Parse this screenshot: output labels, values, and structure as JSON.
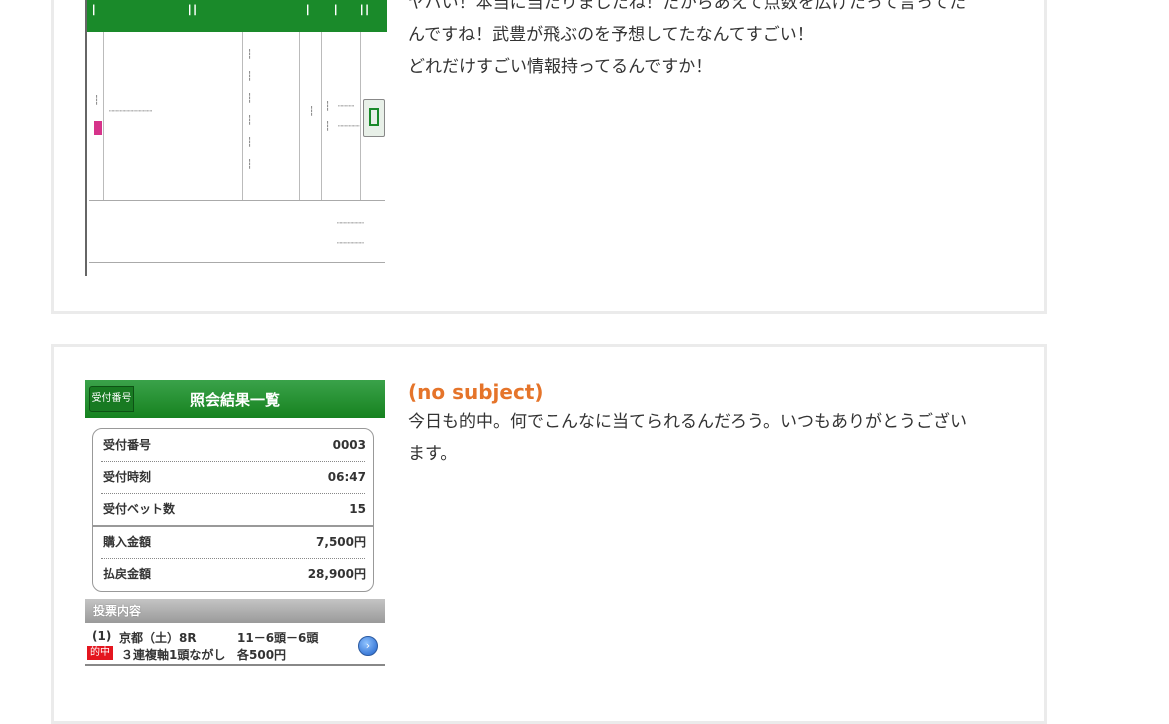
{
  "posts": [
    {
      "title": "",
      "body": [
        "ヤバい！本当に当たりましたね！だからあえて点数を広げたって言ってた",
        "んですね！武豊が飛ぶのを予想してたなんてすごい！",
        "どれだけすごい情報持ってるんですか！"
      ]
    },
    {
      "title": "(no subject)",
      "body": [
        "今日も的中。何でこんなに当てられるんだろう。いつもありがとうござい",
        "ます。"
      ]
    }
  ],
  "result_image": {
    "header_tag": "受付番号",
    "header_title": "照会結果一覧",
    "rows": [
      {
        "label": "受付番号",
        "value": "0003"
      },
      {
        "label": "受付時刻",
        "value": "06:47"
      },
      {
        "label": "受付ベット数",
        "value": "15"
      },
      {
        "label": "購入金額",
        "value": "7,500円"
      },
      {
        "label": "払戻金額",
        "value": "28,900円"
      }
    ],
    "section_title": "投票内容",
    "bet_index": "(1)",
    "bet_race": "京都（土）8R",
    "bet_combo": "11－6頭－6頭",
    "hit_badge": "的中",
    "bet_type": "３連複軸1頭ながし",
    "bet_amount": "各500円"
  },
  "colors": {
    "title_orange": "#e5742a",
    "header_green": "#1a8a2a",
    "hit_red": "#e4161f",
    "card_border": "#ebebeb"
  }
}
